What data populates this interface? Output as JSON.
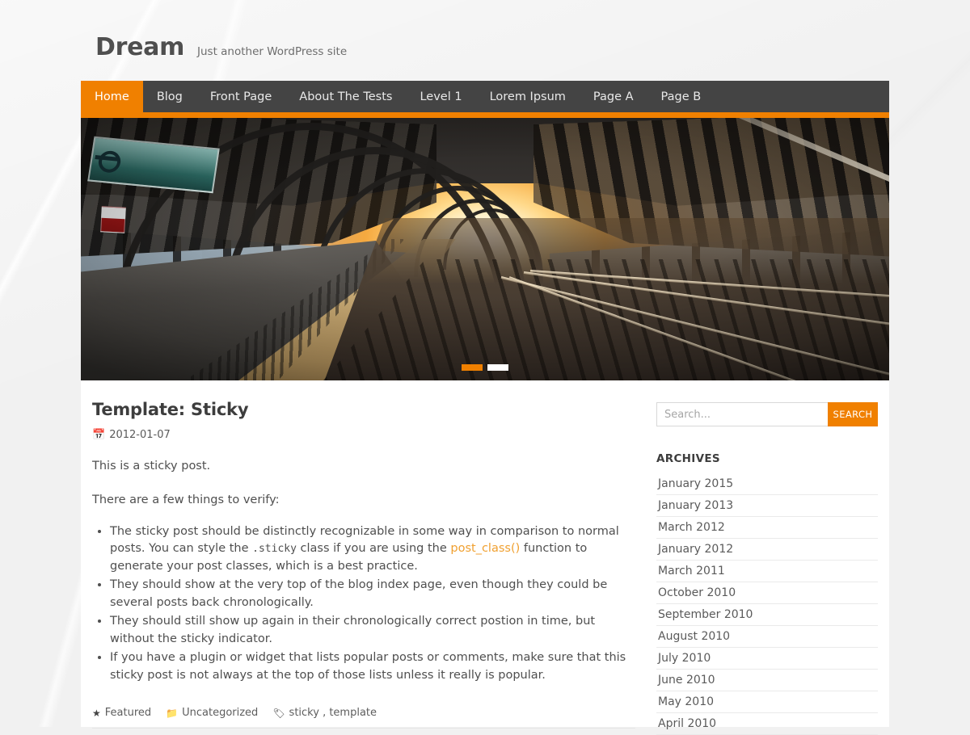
{
  "site": {
    "title": "Dream",
    "tagline": "Just another WordPress site"
  },
  "nav": {
    "items": [
      {
        "label": "Home",
        "active": true
      },
      {
        "label": "Blog",
        "active": false
      },
      {
        "label": "Front Page",
        "active": false
      },
      {
        "label": "About The Tests",
        "active": false
      },
      {
        "label": "Level 1",
        "active": false
      },
      {
        "label": "Lorem Ipsum",
        "active": false
      },
      {
        "label": "Page A",
        "active": false
      },
      {
        "label": "Page B",
        "active": false
      }
    ]
  },
  "hero": {
    "alt": "Train station platform at sunset with arched canopy and converging tracks",
    "slides": 2,
    "active_slide": 1
  },
  "post": {
    "title": "Template: Sticky",
    "date": "2012-01-07",
    "date_icon": "calendar-icon",
    "paragraph_1": "This is a sticky post.",
    "paragraph_2": "There are a few things to verify:",
    "bullets": [
      {
        "part_1": "The sticky post should be distinctly recognizable in some way in comparison to normal posts. You can style the ",
        "code": ".sticky",
        "part_2": " class if you are using the ",
        "link": "post_class()",
        "part_3": " function to generate your post classes, which is a best practice."
      },
      {
        "text": "They should show at the very top of the blog index page, even though they could be several posts back chronologically."
      },
      {
        "text": "They should still show up again in their chronologically correct postion in time, but without the sticky indicator."
      },
      {
        "text": "If you have a plugin or widget that lists popular posts or comments, make sure that this sticky post is not always at the top of those lists unless it really is popular."
      }
    ],
    "meta": {
      "featured_label": "Featured",
      "featured_icon": "star-icon",
      "category_label": "Uncategorized",
      "category_icon": "folder-icon",
      "tags_label": "sticky , template",
      "tags_icon": "tag-icon"
    }
  },
  "sidebar": {
    "search": {
      "placeholder": "Search...",
      "value": "",
      "button_label": "SEARCH"
    },
    "archives": {
      "title": "ARCHIVES",
      "items": [
        "January 2015",
        "January 2013",
        "March 2012",
        "January 2012",
        "March 2011",
        "October 2010",
        "September 2010",
        "August 2010",
        "July 2010",
        "June 2010",
        "May 2010",
        "April 2010"
      ]
    }
  },
  "colors": {
    "accent": "#f08000",
    "nav_bg": "#444444",
    "page_bg": "#f1f1f1",
    "content_bg": "#ffffff",
    "text": "#4f4f4f",
    "link": "#f0a030"
  }
}
